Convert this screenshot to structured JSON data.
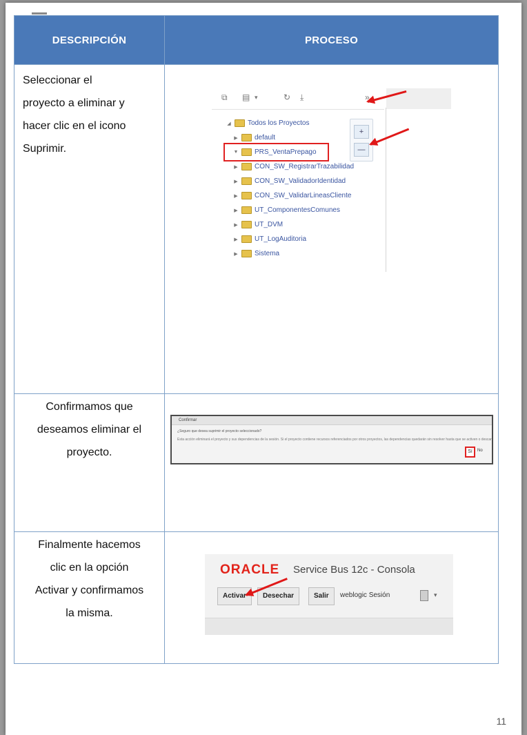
{
  "table": {
    "headers": {
      "description": "DESCRIPCIÓN",
      "process": "PROCESO"
    },
    "rows": [
      {
        "description_lines": [
          "Seleccionar el",
          "proyecto a eliminar y",
          "hacer clic en el icono",
          "Suprimir."
        ]
      },
      {
        "description_lines": [
          "Confirmamos que",
          "deseamos eliminar el",
          "proyecto."
        ]
      },
      {
        "description_lines": [
          "Finalmente hacemos",
          "clic en la opción",
          "Activar y confirmamos",
          "la misma."
        ]
      }
    ]
  },
  "screenshot_1": {
    "toolbar_icons": [
      "copy-icon",
      "paste-icon",
      "chevron-down-icon",
      "refresh-icon",
      "download-icon",
      "double-chevron-right-icon"
    ],
    "side_buttons": [
      "+",
      "—"
    ],
    "tree": [
      {
        "label": "Todos los Proyectos",
        "toggle": "◢",
        "level": 0
      },
      {
        "label": "default",
        "toggle": "▶",
        "level": 1
      },
      {
        "label": "PRS_VentaPrepago",
        "toggle": "▼",
        "level": 1,
        "selected": true
      },
      {
        "label": "CON_SW_RegistrarTrazabilidad",
        "toggle": "▶",
        "level": 1
      },
      {
        "label": "CON_SW_ValidadorIdentidad",
        "toggle": "▶",
        "level": 1
      },
      {
        "label": "CON_SW_ValidarLineasCliente",
        "toggle": "▶",
        "level": 1
      },
      {
        "label": "UT_ComponentesComunes",
        "toggle": "▶",
        "level": 1
      },
      {
        "label": "UT_DVM",
        "toggle": "▶",
        "level": 1
      },
      {
        "label": "UT_LogAuditoria",
        "toggle": "▶",
        "level": 1
      },
      {
        "label": "Sistema",
        "toggle": "▶",
        "level": 1
      }
    ],
    "highlight_color": "#e02020"
  },
  "screenshot_2": {
    "title": "Confirmar",
    "question": "¿Seguro que desea suprimir el proyecto seleccionado?",
    "message": "Esta acción eliminará el proyecto y sus dependencias de la sesión. Si el proyecto contiene recursos referenciados por otros proyectos, las dependencias quedarán sin resolver hasta que se activen o descarten los cambios de la sesión actual.",
    "ok_label": "Sí",
    "no_label": "No"
  },
  "screenshot_3": {
    "brand": "ORACLE",
    "product": "Service Bus 12c - Consola",
    "buttons": [
      "Activar",
      "Desechar",
      "Salir"
    ],
    "user": "weblogic Sesión",
    "brand_color": "#e2231a"
  },
  "page_number": "11"
}
